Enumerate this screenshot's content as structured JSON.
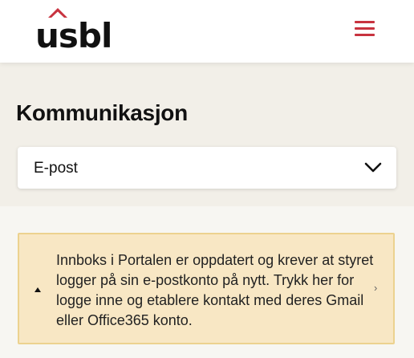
{
  "header": {
    "logo_text": "usbl",
    "menu_icon": "hamburger-menu-icon"
  },
  "page": {
    "title": "Kommunikasjon"
  },
  "dropdown": {
    "selected": "E-post",
    "icon": "chevron-down-icon"
  },
  "notice": {
    "text": "Innboks i Portalen er oppdatert og krever at styret logger på sin e-postkonto på nytt. Trykk her for logge inne og etablere kontakt med deres Gmail eller Office365 konto.",
    "arrow": "›",
    "icon": "caret-up-icon"
  },
  "colors": {
    "brand_red": "#c8333f",
    "band_bg": "#f2efe8",
    "notice_bg": "#f8e7c4",
    "notice_border": "#ecd28f"
  }
}
